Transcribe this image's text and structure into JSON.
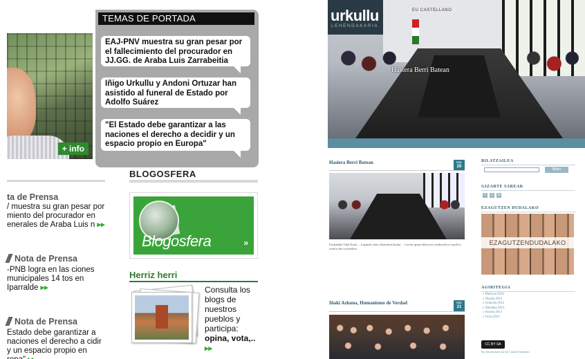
{
  "left": {
    "info_tag": "+ info",
    "temas_header": "TEMAS DE PORTADA",
    "headlines": [
      "EAJ-PNV muestra su gran pesar por el fallecimiento del procurador en JJ.GG. de Araba Luis Zarrabeitia",
      "Iñigo Urkullu y Andoni Ortuzar han asistido al funeral de Estado por Adolfo Suárez",
      "\"El Estado debe garantizar a las naciones el derecho a decidir y un espacio propio en Europa\""
    ],
    "blogosfera_title": "BLOGOSFERA",
    "blogosfera_logo": "Blogosfera",
    "blogosfera_arrow": "»",
    "herriz_title": "Herriz herri",
    "consulta_text": "Consulta los blogs de nuestros pueblos y participa:",
    "consulta_bold": "opina, vota,..",
    "consulta_arrow": "▸▸",
    "notas": [
      {
        "heading": "ta de Prensa",
        "text": "/ muestra su gran pesar por miento del procurador en enerales de Araba Luis n",
        "arrow": "▸▸"
      },
      {
        "heading": "Nota de Prensa",
        "text": "-PNB logra en las ciones municipales 14 tos en Iparralde",
        "arrow": "▸▸"
      },
      {
        "heading": "Nota de Prensa",
        "text": "Estado debe garantizar a naciones el derecho a cidir y un espacio propio en ropa\"",
        "arrow": "▸▸"
      }
    ]
  },
  "right": {
    "brand_name": "urkullu",
    "brand_sub": "LEHENDAKARIA",
    "top_nav": "EU  CASTELLANO",
    "hero_caption": "Hasiera Berri Batean",
    "posts": [
      {
        "title": "Hasiera Berri Batean",
        "month": "Mar",
        "day": "20"
      },
      {
        "title": "Iñaki Azkuna, Humanismo de Verdad",
        "month": "Mar",
        "day": "21"
      }
    ],
    "excerpt": "Euskadiko Udal Eusk… Lagunak asko elkarrekin batuta… Lorem ipsum blah text rendered too small to read in the screenshot.",
    "sidebar": {
      "search_title": "BILATZAILEA",
      "search_button": "Bilatu",
      "social_title": "GIZARTE SAREAK",
      "social_icons": [
        "f",
        "t",
        "in"
      ],
      "ezagutzen_title": "EZAGUTZEN DUDALAKO",
      "ezagutzen_band": "EZAGUTZENDUDALAKO",
      "archive_title": "AGIRITEGIA",
      "archive_items": [
        "» Martxoa 2014",
        "» Otsaila 2014",
        "» Urtarrila 2014",
        "» Abendua 2013",
        "» Azaroa 2013",
        "» Urria 2013"
      ],
      "cc_badge": "CC BY SA",
      "license_text": "Eta ekin dira bere aste bat",
      "license_link": "Creative Commons"
    }
  }
}
